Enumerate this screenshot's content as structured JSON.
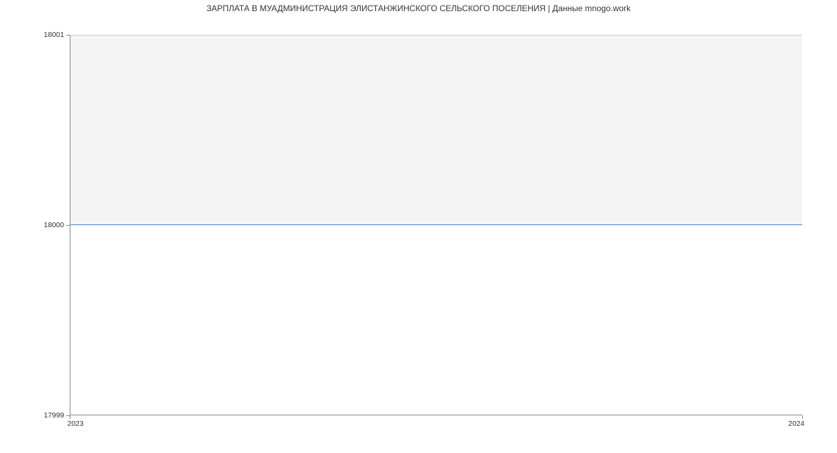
{
  "chart_data": {
    "type": "line",
    "title": "ЗАРПЛАТА В МУАДМИНИСТРАЦИЯ ЭЛИСТАНЖИНСКОГО СЕЛЬСКОГО ПОСЕЛЕНИЯ | Данные mnogo.work",
    "x": [
      2023,
      2024
    ],
    "values": [
      18000,
      18000
    ],
    "xlabel": "",
    "ylabel": "",
    "ylim": [
      17999,
      18001
    ],
    "y_ticks": [
      17999,
      18000,
      18001
    ],
    "x_ticks": [
      2023,
      2024
    ],
    "series_color": "#4a7fd8"
  },
  "title": "ЗАРПЛАТА В МУАДМИНИСТРАЦИЯ ЭЛИСТАНЖИНСКОГО СЕЛЬСКОГО ПОСЕЛЕНИЯ | Данные mnogo.work",
  "y_tick_labels": {
    "top": "18001",
    "mid": "18000",
    "bot": "17999"
  },
  "x_tick_labels": {
    "left": "2023",
    "right": "2024"
  }
}
